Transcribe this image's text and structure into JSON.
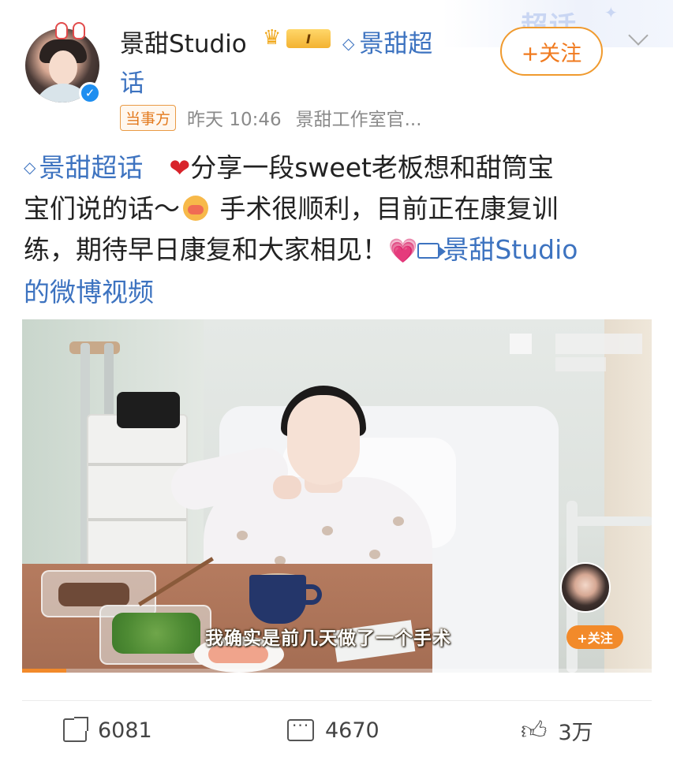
{
  "header": {
    "deco_text": "超话",
    "username": "景甜Studio",
    "level_badge": "I",
    "topic_label": "景甜超",
    "topic_label_cont": "话",
    "follow_label": "+关注",
    "party_badge": "当事方",
    "time": "昨天 10:46",
    "source": "景甜工作室官..."
  },
  "post": {
    "topic_tag": "景甜超话",
    "line1_text": "分享一段sweet老板想和甜筒宝",
    "line2_text": "宝们说的话～",
    "line2_after": " 手术很顺利，目前正在康复训",
    "line3_text": "练，期待早日康复和大家相见！",
    "video_link": "景甜Studio",
    "video_link_cont": "的微博视频"
  },
  "video": {
    "subtitle": "我确实是前几天做了一个手术",
    "mini_follow": "+关注",
    "progress": 0.07,
    "accent": "#f28a2a"
  },
  "footer": {
    "share_count": "6081",
    "comment_count": "4670",
    "like_count": "3万"
  },
  "icons": {
    "verified": "verified-check-icon",
    "crown": "crown-icon",
    "topic": "diamond-topic-icon",
    "video": "video-icon",
    "share": "share-icon",
    "comment": "comment-icon",
    "like": "thumbs-up-icon"
  },
  "colors": {
    "link": "#3d73c0",
    "follow": "#f07a1e",
    "heart": "#d8232a"
  }
}
